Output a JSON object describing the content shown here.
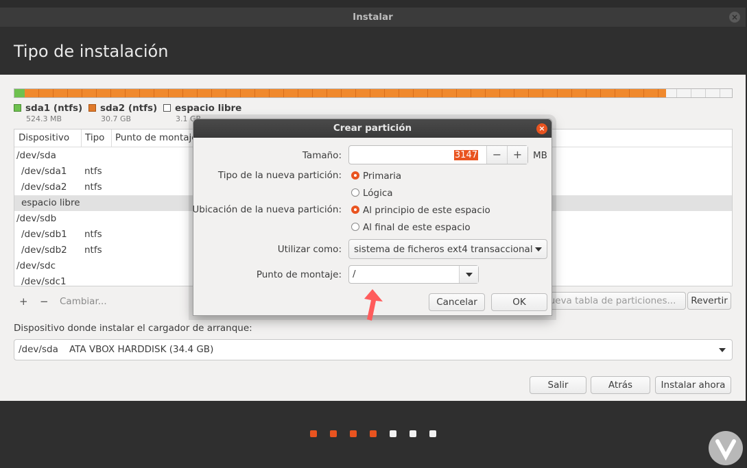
{
  "window": {
    "title": "Instalar",
    "close_icon": "close-icon"
  },
  "page_title": "Tipo de instalación",
  "partition_bar": {
    "legend": [
      {
        "name": "sda1 (ntfs)",
        "size": "524.3 MB",
        "color": "#6ec14f"
      },
      {
        "name": "sda2 (ntfs)",
        "size": "30.7 GB",
        "color": "#e07a2a"
      },
      {
        "name": "espacio libre",
        "size": "3.1 GB",
        "color": "#ffffff"
      }
    ]
  },
  "table": {
    "headers": [
      "Dispositivo",
      "Tipo",
      "Punto de montaje"
    ],
    "rows": [
      {
        "device": "/dev/sda",
        "type": ""
      },
      {
        "device": "/dev/sda1",
        "type": "ntfs"
      },
      {
        "device": "/dev/sda2",
        "type": "ntfs"
      },
      {
        "device": "espacio libre",
        "type": "",
        "selected": true
      },
      {
        "device": "/dev/sdb",
        "type": ""
      },
      {
        "device": "/dev/sdb1",
        "type": "ntfs"
      },
      {
        "device": "/dev/sdb2",
        "type": "ntfs"
      },
      {
        "device": "/dev/sdc",
        "type": ""
      },
      {
        "device": "/dev/sdc1",
        "type": ""
      }
    ]
  },
  "table_tools": {
    "add": "+",
    "remove": "−",
    "change": "Cambiar..."
  },
  "buttons": {
    "new_table": "Nueva tabla de particiones...",
    "revert": "Revertir",
    "quit": "Salir",
    "back": "Atrás",
    "install": "Instalar ahora"
  },
  "bootloader": {
    "label": "Dispositivo donde instalar el cargador de arranque:",
    "device": "/dev/sda",
    "description": "ATA VBOX HARDDISK (34.4 GB)"
  },
  "dialog": {
    "title": "Crear partición",
    "size_label": "Tamaño:",
    "size_value": "3147",
    "size_unit": "MB",
    "minus": "−",
    "plus": "+",
    "type_label": "Tipo de la nueva partición:",
    "type_options": [
      "Primaria",
      "Lógica"
    ],
    "type_selected": 0,
    "location_label": "Ubicación de la nueva partición:",
    "location_options": [
      "Al principio de este espacio",
      "Al final de este espacio"
    ],
    "location_selected": 0,
    "use_as_label": "Utilizar como:",
    "use_as_value": "sistema de ficheros ext4 transaccional",
    "mount_label": "Punto de montaje:",
    "mount_value": "/",
    "cancel": "Cancelar",
    "ok": "OK"
  },
  "progress_dots": {
    "total": 7,
    "completed": 4,
    "done_color": "#e95420",
    "todo_color": "#f2f2f2"
  }
}
